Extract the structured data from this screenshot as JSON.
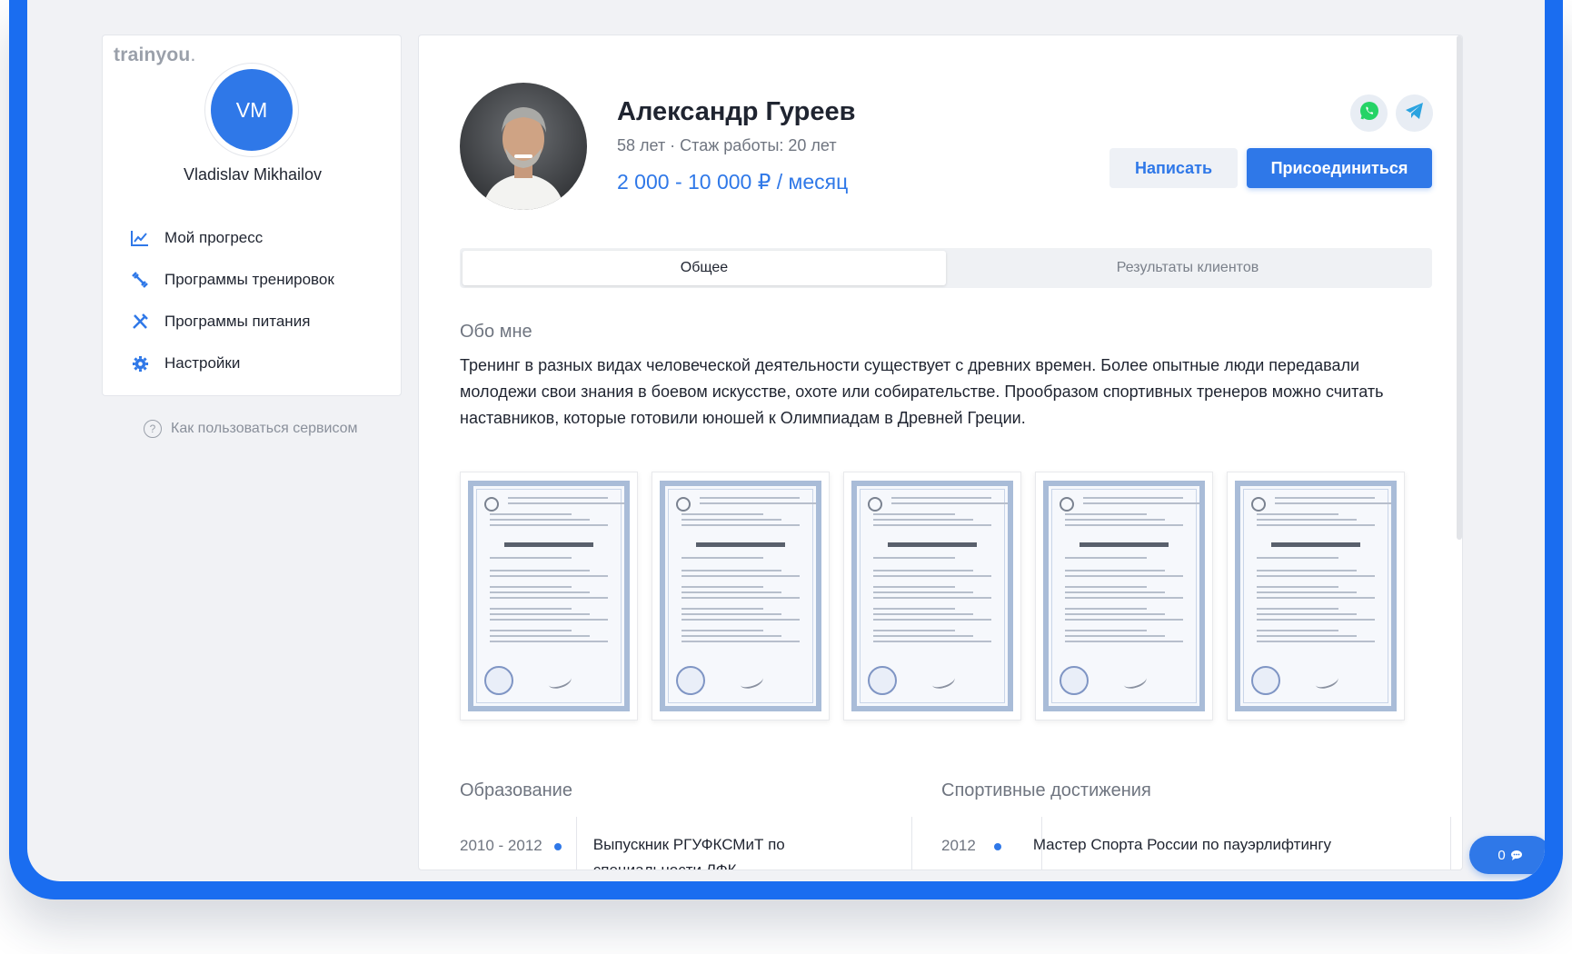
{
  "sidebar": {
    "logo": "trainyou",
    "logo_dot": ".",
    "avatar_initials": "VM",
    "user_name": "Vladislav Mikhailov",
    "nav": [
      {
        "label": "Мой прогресс",
        "icon": "chart-line-icon"
      },
      {
        "label": "Программы тренировок",
        "icon": "dumbbell-icon"
      },
      {
        "label": "Программы питания",
        "icon": "fork-knife-icon"
      },
      {
        "label": "Настройки",
        "icon": "gear-icon"
      }
    ],
    "help": {
      "icon_text": "?",
      "label": "Как пользоваться сервисом"
    }
  },
  "profile": {
    "name": "Александр Гуреев",
    "meta": "58 лет · Стаж работы: 20 лет",
    "price": "2 000 - 10 000 ₽ / месяц",
    "write_label": "Написать",
    "join_label": "Присоединиться"
  },
  "tabs": [
    {
      "label": "Общее",
      "active": true
    },
    {
      "label": "Результаты клиентов",
      "active": false
    }
  ],
  "about": {
    "title": "Обо мне",
    "text": "Тренинг в разных видах человеческой деятельности существует с древних времен. Более опытные люди передавали молодежи свои знания в боевом искусстве, охоте или собирательстве. Прообразом спортивных тренеров можно считать наставников, которые готовили юношей к Олимпиадам в Древней Греции."
  },
  "education": {
    "title": "Образование",
    "items": [
      {
        "year": "2010 - 2012",
        "text": "Выпускник РГУФКСМиТ по специальности ЛФК"
      }
    ]
  },
  "achievements": {
    "title": "Спортивные достижения",
    "items": [
      {
        "year": "2012",
        "text": "Мастер Спорта России по пауэрлифтингу"
      }
    ]
  },
  "chat": {
    "count": "0"
  },
  "colors": {
    "accent": "#2f78e8",
    "frame": "#1a6df0",
    "whatsapp": "#25d366",
    "telegram": "#2aa3e0"
  }
}
